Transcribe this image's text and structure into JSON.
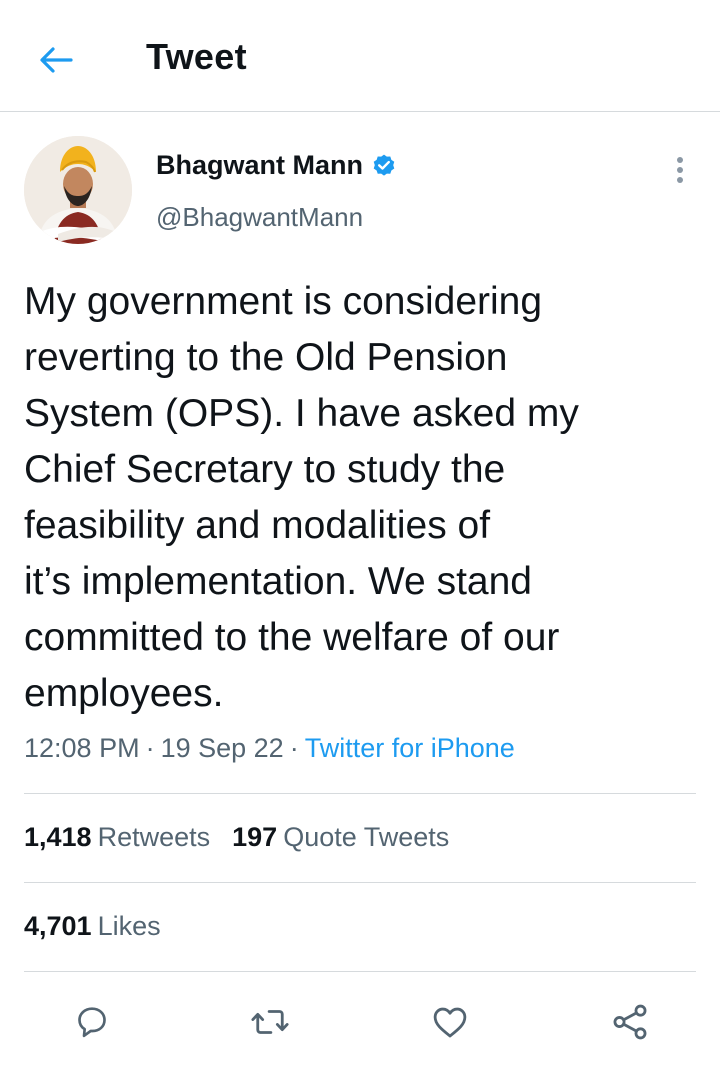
{
  "header": {
    "title": "Tweet",
    "back_icon": "arrow-left-icon",
    "accent_color": "#1d9bf0"
  },
  "author": {
    "name": "Bhagwant Mann",
    "handle": "@BhagwantMann",
    "verified": true,
    "verified_icon": "verified-badge-icon",
    "verified_color": "#1d9bf0"
  },
  "tweet": {
    "text": "My government is considering\nreverting to the Old Pension\nSystem (OPS). I have asked my\nChief Secretary to study the\nfeasibility and modalities of\nit’s implementation. We stand\ncommitted to the welfare of our\nemployees.",
    "time": "12:08 PM",
    "separator": "·",
    "date": "19 Sep 22",
    "source": "Twitter for iPhone"
  },
  "stats": {
    "retweets_count": "1,418",
    "retweets_label": "Retweets",
    "quotes_count": "197",
    "quotes_label": "Quote Tweets",
    "likes_count": "4,701",
    "likes_label": "Likes"
  },
  "actions": [
    {
      "icon": "reply-icon"
    },
    {
      "icon": "retweet-icon"
    },
    {
      "icon": "like-icon"
    },
    {
      "icon": "share-icon"
    }
  ],
  "colors": {
    "text_primary": "#0f1419",
    "text_secondary": "#536471",
    "divider": "#d6dadd",
    "link": "#1d9bf0"
  }
}
